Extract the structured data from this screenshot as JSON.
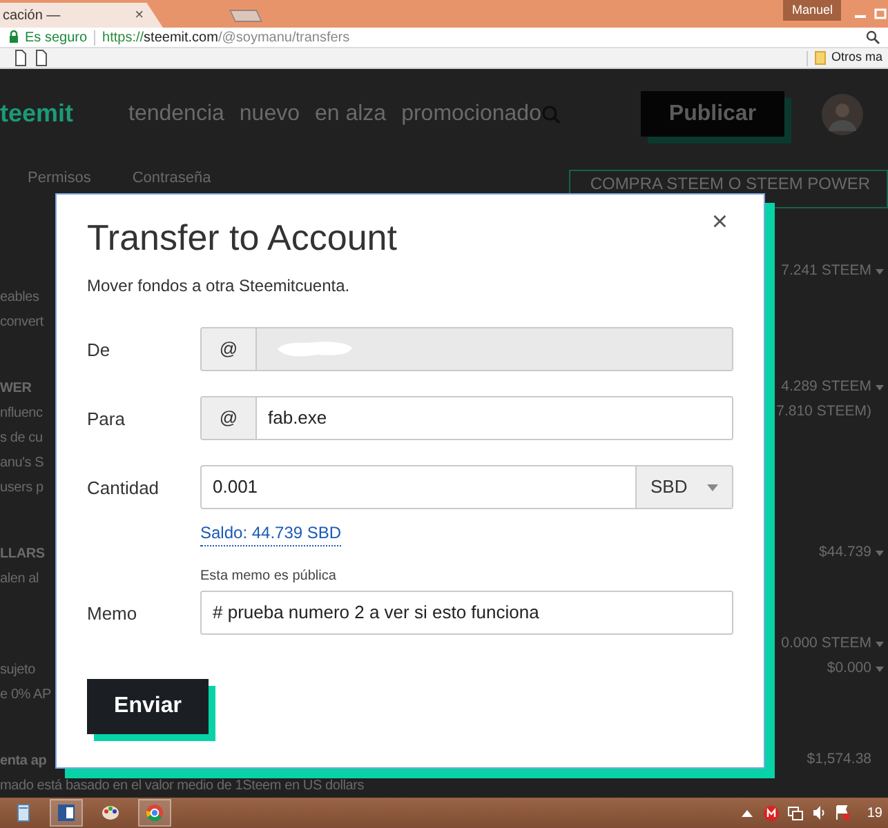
{
  "browser": {
    "tab": {
      "title": "cación —",
      "close": "×"
    },
    "profile": "Manuel",
    "security": "Es seguro",
    "url": {
      "scheme": "https://",
      "host": "steemit.com",
      "path": "/@soymanu/transfers"
    },
    "bookmarks_folder": "Otros ma"
  },
  "site": {
    "logo": "teemit",
    "nav": [
      "tendencia",
      "nuevo",
      "en alza",
      "promocionado"
    ],
    "publish": "Publicar",
    "tabs": [
      "Permisos",
      "Contraseña"
    ],
    "buy_button": "COMPRA STEEM O STEEM POWER",
    "sections": [
      {
        "rows": [
          {
            "right": "7.241 STEEM",
            "dropdown": true
          },
          {
            "left": "eables"
          },
          {
            "left": "convert"
          }
        ]
      },
      {
        "rows": [
          {
            "left": "WER",
            "title": true,
            "right": "4.289 STEEM",
            "dropdown": true
          },
          {
            "left": "nfluenc",
            "right": "7.810 STEEM)",
            "dropdown": false
          },
          {
            "left": "s de cu"
          },
          {
            "left": "anu's S"
          },
          {
            "left": "users p"
          }
        ]
      },
      {
        "rows": [
          {
            "left": "LLARS",
            "title": true,
            "right": "$44.739",
            "dropdown": true
          },
          {
            "left": "alen al"
          }
        ]
      },
      {
        "rows": [
          {
            "right": "0.000 STEEM",
            "dropdown": true
          },
          {
            "left": "sujeto",
            "right": "$0.000",
            "dropdown": true
          },
          {
            "left": "e 0% AP"
          }
        ]
      },
      {
        "rows": [
          {
            "left": "enta ap",
            "title": true,
            "right": "$1,574.38",
            "dropdown": false
          },
          {
            "left": "mado está basado en el valor medio de 1Steem en US dollars"
          }
        ]
      }
    ]
  },
  "modal": {
    "title": "Transfer to Account",
    "subtitle": "Mover fondos a otra Steemitcuenta.",
    "close": "×",
    "fields": [
      {
        "kind": "account",
        "label": "De",
        "prefix": "@",
        "disabled": true,
        "redacted": true
      },
      {
        "kind": "account",
        "label": "Para",
        "prefix": "@",
        "value": "fab.exe",
        "disabled": false
      },
      {
        "kind": "amount",
        "label": "Cantidad",
        "value": "0.001",
        "currency": "SBD",
        "balance": "Saldo: 44.739 SBD"
      },
      {
        "kind": "memo",
        "label": "Memo",
        "hint": "Esta memo es pública",
        "value": "# prueba numero 2 a ver si esto funciona"
      }
    ],
    "submit": "Enviar"
  },
  "taskbar": {
    "apps": [
      {
        "kind": "file",
        "selected": false
      },
      {
        "kind": "word",
        "selected": true
      },
      {
        "kind": "paint",
        "selected": false
      },
      {
        "kind": "chrome",
        "selected": true
      }
    ],
    "clock": "19"
  }
}
